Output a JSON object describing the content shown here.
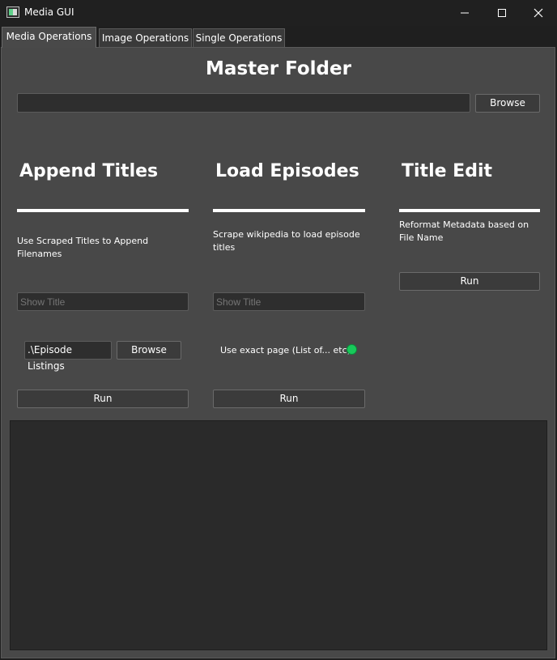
{
  "window": {
    "title": "Media GUI",
    "icon": "app-window-icon"
  },
  "tabs": [
    "Media Operations",
    "Image Operations",
    "Single Operations"
  ],
  "master": {
    "heading": "Master Folder",
    "path_value": "",
    "browse_label": "Browse"
  },
  "append": {
    "title": "Append Titles",
    "description": "Use Scraped Titles to Append Filenames",
    "show_title_placeholder": "Show Title",
    "listing_value": ".\\Episode Listings",
    "browse_label": "Browse",
    "run_label": "Run"
  },
  "load": {
    "title": "Load Episodes",
    "description": "Scrape wikipedia to load episode titles",
    "show_title_placeholder": "Show Title",
    "exact_label": "Use exact page (List of... etc)",
    "run_label": "Run"
  },
  "edit": {
    "title": "Title Edit",
    "description": "Reformat Metadata based on File Name",
    "run_label": "Run"
  },
  "colors": {
    "background": "#484848",
    "indicator": "#18c95a",
    "rule": "#ffffff"
  }
}
